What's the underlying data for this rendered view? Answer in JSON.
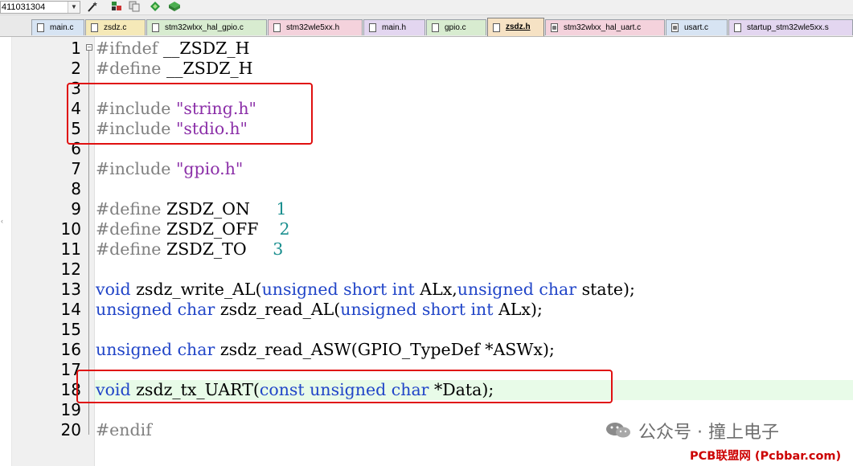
{
  "toolbar": {
    "target_value": "411031304",
    "icons": [
      "magic-wand-icon",
      "build-icon",
      "copy-icon",
      "diamond-icon",
      "package-icon"
    ]
  },
  "tabs": [
    {
      "label": "main.c",
      "color": "#d7e4f3",
      "active": false,
      "modified": false
    },
    {
      "label": "zsdz.c",
      "color": "#f5e9b8",
      "active": false,
      "modified": false
    },
    {
      "label": "stm32wlxx_hal_gpio.c",
      "color": "#d8ecd0",
      "active": false,
      "modified": false
    },
    {
      "label": "stm32wle5xx.h",
      "color": "#f4d2dc",
      "active": false,
      "modified": false
    },
    {
      "label": "main.h",
      "color": "#e3d6f0",
      "active": false,
      "modified": false
    },
    {
      "label": "gpio.c",
      "color": "#d8ecd0",
      "active": false,
      "modified": false
    },
    {
      "label": "zsdz.h",
      "color": "#f6e2c4",
      "active": true,
      "modified": false
    },
    {
      "label": "stm32wlxx_hal_uart.c",
      "color": "#f4d2dc",
      "active": false,
      "modified": true
    },
    {
      "label": "usart.c",
      "color": "#d7e4f3",
      "active": false,
      "modified": true
    },
    {
      "label": "startup_stm32wle5xx.s",
      "color": "#e3d6f0",
      "active": false,
      "modified": false
    }
  ],
  "editor": {
    "highlight_color": "#e8fbe8",
    "lines": [
      {
        "n": "1",
        "tokens": [
          [
            "pp",
            "#ifndef"
          ],
          [
            "id",
            " __ZSDZ_H"
          ]
        ]
      },
      {
        "n": "2",
        "tokens": [
          [
            "pp",
            "#define"
          ],
          [
            "id",
            " __ZSDZ_H"
          ]
        ]
      },
      {
        "n": "3",
        "tokens": []
      },
      {
        "n": "4",
        "tokens": [
          [
            "pp",
            "#include"
          ],
          [
            "id",
            " "
          ],
          [
            "str",
            "\"string.h\""
          ]
        ]
      },
      {
        "n": "5",
        "tokens": [
          [
            "pp",
            "#include"
          ],
          [
            "id",
            " "
          ],
          [
            "str",
            "\"stdio.h\""
          ]
        ]
      },
      {
        "n": "6",
        "tokens": []
      },
      {
        "n": "7",
        "tokens": [
          [
            "pp",
            "#include"
          ],
          [
            "id",
            " "
          ],
          [
            "str",
            "\"gpio.h\""
          ]
        ]
      },
      {
        "n": "8",
        "tokens": []
      },
      {
        "n": "9",
        "tokens": [
          [
            "pp",
            "#define"
          ],
          [
            "id",
            " ZSDZ_ON     "
          ],
          [
            "num",
            "1"
          ]
        ]
      },
      {
        "n": "10",
        "tokens": [
          [
            "pp",
            "#define"
          ],
          [
            "id",
            " ZSDZ_OFF    "
          ],
          [
            "num",
            "2"
          ]
        ]
      },
      {
        "n": "11",
        "tokens": [
          [
            "pp",
            "#define"
          ],
          [
            "id",
            " ZSDZ_TO     "
          ],
          [
            "num",
            "3"
          ]
        ]
      },
      {
        "n": "12",
        "tokens": []
      },
      {
        "n": "13",
        "tokens": [
          [
            "kw",
            "void"
          ],
          [
            "id",
            " zsdz_write_AL("
          ],
          [
            "kw",
            "unsigned short int"
          ],
          [
            "id",
            " ALx,"
          ],
          [
            "kw",
            "unsigned char"
          ],
          [
            "id",
            " state);"
          ]
        ]
      },
      {
        "n": "14",
        "tokens": [
          [
            "kw",
            "unsigned char"
          ],
          [
            "id",
            " zsdz_read_AL("
          ],
          [
            "kw",
            "unsigned short int"
          ],
          [
            "id",
            " ALx);"
          ]
        ]
      },
      {
        "n": "15",
        "tokens": []
      },
      {
        "n": "16",
        "tokens": [
          [
            "kw",
            "unsigned char"
          ],
          [
            "id",
            " zsdz_read_ASW(GPIO_TypeDef *ASWx);"
          ]
        ]
      },
      {
        "n": "17",
        "tokens": []
      },
      {
        "n": "18",
        "tokens": [
          [
            "kw",
            "void"
          ],
          [
            "id",
            " zsdz_tx_UART("
          ],
          [
            "kw",
            "const unsigned char"
          ],
          [
            "id",
            " *Data);"
          ]
        ],
        "highlight": true
      },
      {
        "n": "19",
        "tokens": []
      },
      {
        "n": "20",
        "tokens": [
          [
            "pp",
            "#endif"
          ]
        ]
      }
    ]
  },
  "annotation_color": "#e01010",
  "watermark": {
    "account": "公众号 · 撞上电子",
    "site": "PCB联盟网 (Pcbbar.com)"
  }
}
